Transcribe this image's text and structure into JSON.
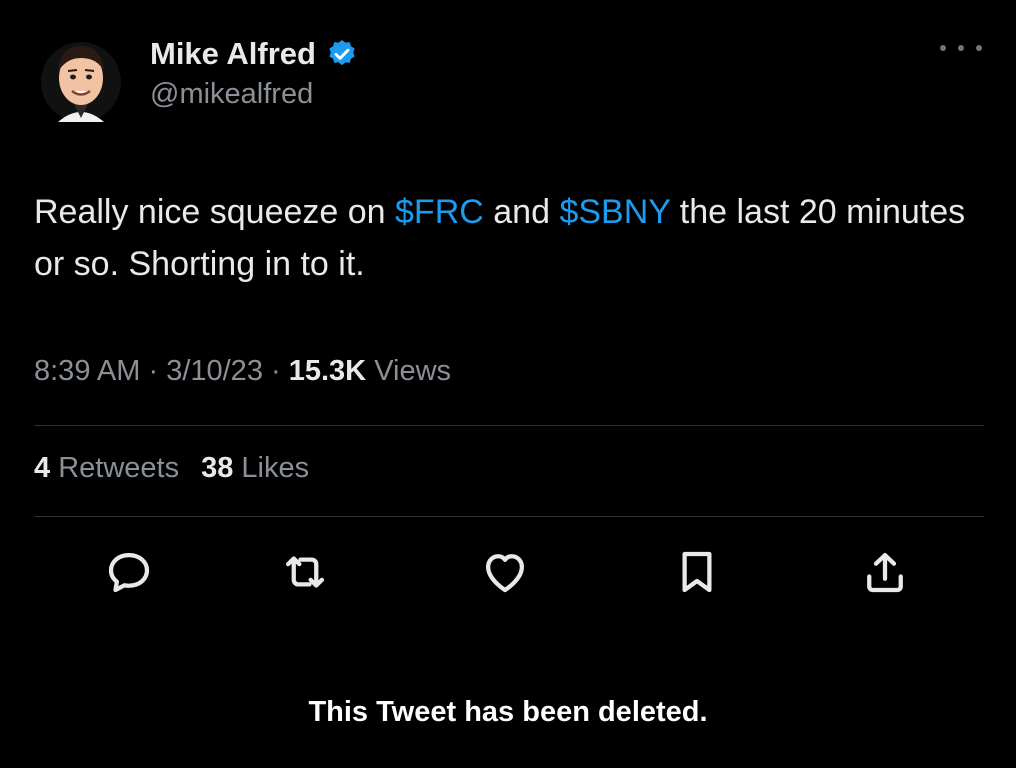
{
  "author": {
    "display_name": "Mike Alfred",
    "handle": "@mikealfred",
    "verified": true
  },
  "tweet": {
    "text_parts": [
      {
        "text": "Really nice squeeze on ",
        "type": "text"
      },
      {
        "text": "$FRC",
        "type": "cashtag"
      },
      {
        "text": " and ",
        "type": "text"
      },
      {
        "text": "$SBNY",
        "type": "cashtag"
      },
      {
        "text": " the last 20 minutes or so. Shorting in to it.",
        "type": "text"
      }
    ],
    "time": "8:39 AM",
    "date": "3/10/23",
    "separator": " · ",
    "views_count": "15.3K",
    "views_label": "Views"
  },
  "stats": {
    "retweets_count": "4",
    "retweets_label": "Retweets",
    "likes_count": "38",
    "likes_label": "Likes"
  },
  "actions": {
    "icons": [
      "reply-icon",
      "retweet-icon",
      "like-icon",
      "bookmark-icon",
      "share-icon"
    ]
  },
  "notice": "This Tweet has been deleted.",
  "colors": {
    "background": "#000000",
    "accent": "#1d9bf0",
    "muted_text": "#8b9096",
    "divider": "#2f3336"
  }
}
